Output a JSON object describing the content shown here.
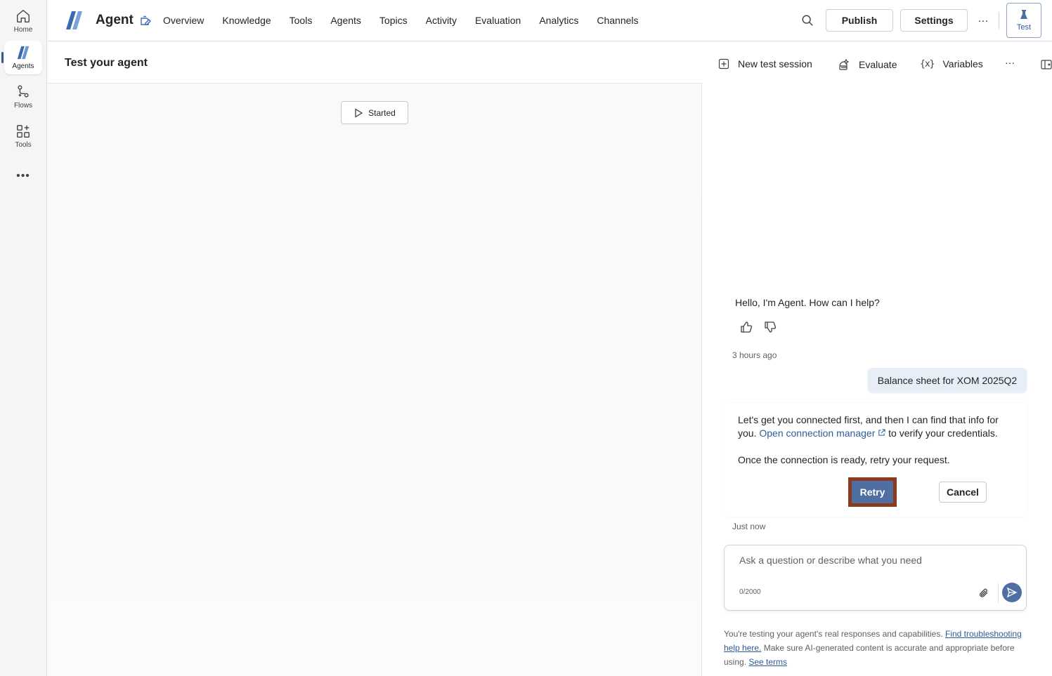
{
  "rail": {
    "items": [
      {
        "label": "Home",
        "icon": "home-icon"
      },
      {
        "label": "Agents",
        "icon": "agents-icon"
      },
      {
        "label": "Flows",
        "icon": "flows-icon"
      },
      {
        "label": "Tools",
        "icon": "tools-icon"
      }
    ],
    "more": "•••"
  },
  "header": {
    "app_name": "Agent",
    "nav": [
      "Overview",
      "Knowledge",
      "Tools",
      "Agents",
      "Topics",
      "Activity",
      "Evaluation",
      "Analytics",
      "Channels"
    ],
    "publish_label": "Publish",
    "settings_label": "Settings",
    "more_label": "···",
    "test_label": "Test"
  },
  "canvas": {
    "title": "Test your agent",
    "started_label": "Started"
  },
  "panel": {
    "new_session_label": "New test session",
    "evaluate_label": "Evaluate",
    "variables_label": "Variables",
    "variables_glyph": "{x}",
    "more_label": "···"
  },
  "chat": {
    "greeting": "Hello, I'm Agent. How can I help?",
    "greeting_time": "3 hours ago",
    "user_message": "Balance sheet for XOM 2025Q2",
    "reply_part1": "Let's get you connected first, and then I can find that info for you. ",
    "reply_link": "Open connection manager",
    "reply_part2": " to verify your credentials.",
    "reply_line2": "Once the connection is ready, retry your request.",
    "retry_label": "Retry",
    "cancel_label": "Cancel",
    "reply_time": "Just now"
  },
  "composer": {
    "placeholder": "Ask a question or describe what you need",
    "counter": "0/2000"
  },
  "disclaimer": {
    "part1": "You're testing your agent's real responses and capabilities. ",
    "link1": "Find troubleshooting help here.",
    "part2": " Make sure AI-generated content is accurate and appropriate before using. ",
    "link2": "See terms"
  },
  "colors": {
    "accent": "#2f5b9a",
    "primary_button": "#4f6fa3",
    "highlight_border": "#8b3a1e",
    "user_bubble": "#e8eef7"
  }
}
